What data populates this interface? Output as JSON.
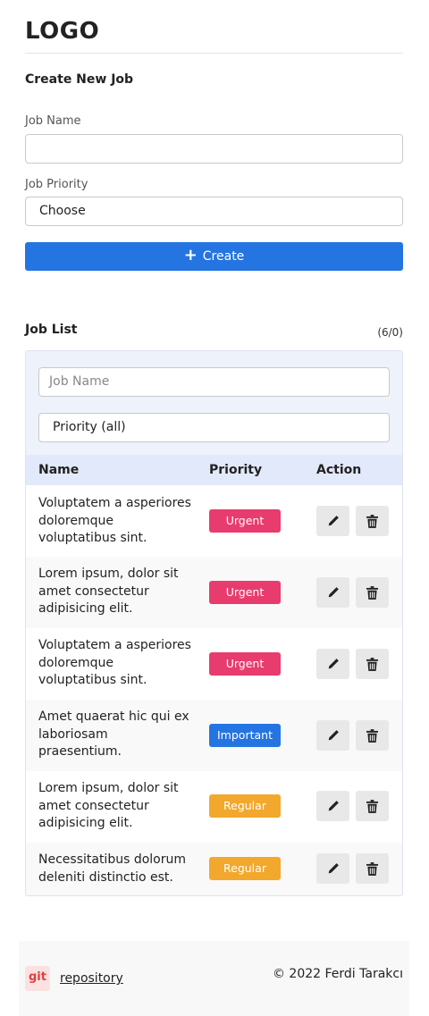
{
  "header": {
    "logo": "LOGO"
  },
  "create_form": {
    "title": "Create New Job",
    "job_name_label": "Job Name",
    "job_name_value": "",
    "job_priority_label": "Job Priority",
    "job_priority_value": "Choose",
    "create_button_label": "Create"
  },
  "job_list": {
    "title": "Job List",
    "count": "(6/0)",
    "filter_name_placeholder": "Job Name",
    "filter_priority_value": "Priority (all)",
    "columns": {
      "name": "Name",
      "priority": "Priority",
      "action": "Action"
    },
    "rows": [
      {
        "name": "Voluptatem a asperiores doloremque voluptatibus sint.",
        "priority": "Urgent"
      },
      {
        "name": "Lorem ipsum, dolor sit amet consectetur adipisicing elit.",
        "priority": "Urgent"
      },
      {
        "name": "Voluptatem a asperiores doloremque voluptatibus sint.",
        "priority": "Urgent"
      },
      {
        "name": "Amet quaerat hic qui ex laboriosam praesentium.",
        "priority": "Important"
      },
      {
        "name": "Lorem ipsum, dolor sit amet consectetur adipisicing elit.",
        "priority": "Regular"
      },
      {
        "name": "Necessitatibus dolorum deleniti distinctio est.",
        "priority": "Regular"
      }
    ]
  },
  "footer": {
    "git_badge": "git",
    "repository_link": "repository",
    "copyright": "© 2022 Ferdi Tarakcı"
  },
  "colors": {
    "primary": "#2475e2",
    "urgent": "#e83c6e",
    "important": "#2475e2",
    "regular": "#f2a82c"
  },
  "icons": {
    "create": "plus-icon",
    "edit": "pencil-icon",
    "delete": "trash-icon"
  }
}
